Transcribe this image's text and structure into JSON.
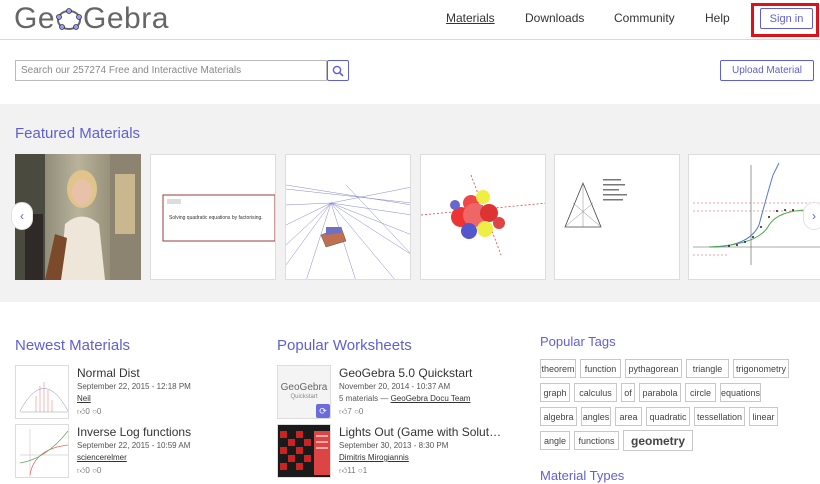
{
  "header": {
    "logo_left": "Ge",
    "logo_right": "Gebra",
    "nav": [
      "Materials",
      "Downloads",
      "Community",
      "Help"
    ],
    "sign_in": "Sign in"
  },
  "search": {
    "placeholder": "Search our 257274 Free and Interactive Materials",
    "upload_label": "Upload Material"
  },
  "featured": {
    "title": "Featured Materials",
    "thumb2_label": "Solving quadratic equations by factorising."
  },
  "newest": {
    "title": "Newest Materials",
    "items": [
      {
        "title": "Normal Dist",
        "date": "September 22, 2015 - 12:18 PM",
        "author": "Neil",
        "likes": "0",
        "comments": "0"
      },
      {
        "title": "Inverse Log functions",
        "date": "September 22, 2015 - 10:59 AM",
        "author": "sciencerelmer",
        "likes": "0",
        "comments": "0"
      }
    ]
  },
  "popular_worksheets": {
    "title": "Popular Worksheets",
    "items": [
      {
        "title": "GeoGebra 5.0 Quickstart",
        "date": "November 20, 2014 - 10:37 AM",
        "materials": "5 materials — ",
        "author": "GeoGebra Docu Team",
        "likes": "7",
        "comments": "0",
        "thumb_line1": "GeoGebra",
        "thumb_line2": "Quickstart"
      },
      {
        "title": "Lights Out (Game with Solut…",
        "date": "September 30, 2013 - 8:30 PM",
        "author": "Dimitris Mirogiannis",
        "likes": "11",
        "comments": "1"
      }
    ]
  },
  "popular_tags": {
    "title": "Popular Tags",
    "tags": [
      "theorem",
      "function",
      "pythagorean",
      "triangle",
      "trigonometry",
      "graph",
      "calculus",
      "of",
      "parabola",
      "circle",
      "equations",
      "algebra",
      "angles",
      "area",
      "quadratic",
      "tessellation",
      "linear",
      "angle",
      "functions",
      "geometry"
    ]
  },
  "material_types": {
    "title": "Material Types"
  },
  "colors": {
    "accent": "#5f5fd5",
    "highlight": "#e0101a"
  }
}
